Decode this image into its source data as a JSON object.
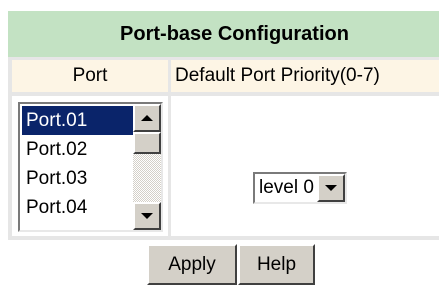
{
  "title": "Port-base Configuration",
  "headers": {
    "port": "Port",
    "priority": "Default Port Priority(0-7)"
  },
  "port_list": {
    "items": [
      "Port.01",
      "Port.02",
      "Port.03",
      "Port.04"
    ],
    "selected": "Port.01"
  },
  "priority_select": {
    "value": "level 0"
  },
  "buttons": {
    "apply": "Apply",
    "help": "Help"
  },
  "colors": {
    "title_bg": "#c3e2c3",
    "header_bg": "#fdf5e5",
    "frame_bg": "#e6e6e6",
    "selection_bg": "#0a246a",
    "button_face": "#d4d0c8"
  }
}
